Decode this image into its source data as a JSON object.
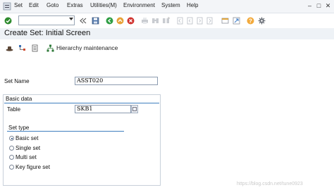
{
  "menu": {
    "items": [
      "Set",
      "Edit",
      "Goto",
      "Extras",
      "Utilities(M)",
      "Environment",
      "System",
      "Help"
    ]
  },
  "toolbar": {
    "command_field_value": "",
    "icons": [
      "check-icon",
      "double-left-arrow-icon",
      "save-icon",
      "back-icon",
      "exit-icon",
      "cancel-icon",
      "print-icon",
      "find-icon",
      "find-next-icon",
      "first-page-icon",
      "prev-page-icon",
      "next-page-icon",
      "last-page-icon",
      "new-session-icon",
      "shortcut-icon",
      "help-icon",
      "settings-icon"
    ]
  },
  "title": "Create Set: Initial Screen",
  "app_toolbar": {
    "hierarchy_label": "Hierarchy maintenance"
  },
  "form": {
    "set_name_label": "Set Name",
    "set_name_value": "ASST020",
    "basic_data_title": "Basic data",
    "table_label": "Table",
    "table_value": "SKB1",
    "set_type_title": "Set type",
    "set_types": [
      {
        "label": "Basic set",
        "checked": true
      },
      {
        "label": "Single set",
        "checked": false
      },
      {
        "label": "Multi set",
        "checked": false
      },
      {
        "label": "Key figure set",
        "checked": false
      }
    ]
  },
  "colors": {
    "accent": "#3f7fbf",
    "check_green": "#2e8b2e",
    "back_green": "#2f9e44",
    "exit_orange": "#e8a33a",
    "cancel_red": "#d0312d",
    "help_orange": "#f2a93b"
  },
  "watermark": "https://blog.csdn.net/tune0923"
}
